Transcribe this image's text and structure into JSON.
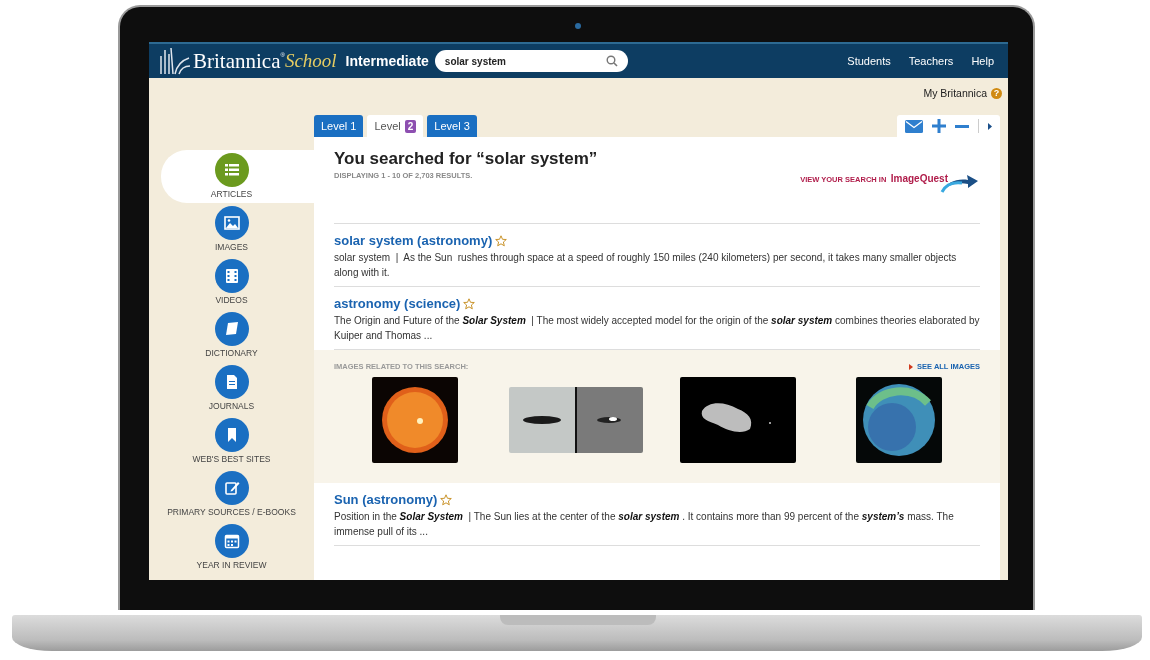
{
  "header": {
    "logo": {
      "brand": "Britannica",
      "registered": "®",
      "product": "School"
    },
    "edition": "Intermediate",
    "search": {
      "value": "solar system"
    },
    "nav": [
      "Students",
      "Teachers",
      "Help"
    ]
  },
  "account": {
    "label": "My Britannica",
    "help": "?"
  },
  "sidebar": {
    "items": [
      {
        "label": "ARTICLES",
        "kind": "articles",
        "selected": true
      },
      {
        "label": "IMAGES",
        "kind": "images",
        "selected": false
      },
      {
        "label": "VIDEOS",
        "kind": "videos",
        "selected": false
      },
      {
        "label": "DICTIONARY",
        "kind": "dictionary",
        "selected": false
      },
      {
        "label": "JOURNALS",
        "kind": "journals",
        "selected": false
      },
      {
        "label": "WEB'S BEST SITES",
        "kind": "sites",
        "selected": false
      },
      {
        "label": "PRIMARY SOURCES / E-BOOKS",
        "kind": "sources",
        "selected": false
      },
      {
        "label": "YEAR IN REVIEW",
        "kind": "year",
        "selected": false
      }
    ]
  },
  "tabs": [
    {
      "label": "Level 1",
      "selected": false
    },
    {
      "label": "Level",
      "badge": "2",
      "selected": true
    },
    {
      "label": "Level 3",
      "selected": false
    }
  ],
  "search_results": {
    "heading": "You searched for “solar system”",
    "count": "DISPLAYING 1 - 10 OF 2,703 RESULTS.",
    "imagequest_link": {
      "prefix": "VIEW YOUR SEARCH IN",
      "brand": "ImageQuest"
    },
    "results": [
      {
        "title": "solar system (astronomy)",
        "snippet": "solar system  |  As the Sun  rushes through space at a speed of roughly 150 miles (240 kilometers) per second, it takes many smaller objects along with it."
      },
      {
        "title": "astronomy (science)",
        "snippet": "The Origin and Future of the **Solar System**  | The most widely accepted model for the origin of the **solar system** combines theories elaborated by Kuiper and Thomas ..."
      }
    ],
    "images": {
      "label": "IMAGES RELATED TO THIS SEARCH:",
      "see_all": "SEE ALL IMAGES",
      "items": [
        {
          "kind": "sun"
        },
        {
          "kind": "blur"
        },
        {
          "kind": "asteroid"
        },
        {
          "kind": "planet"
        }
      ]
    },
    "more_results": [
      {
        "title": "Sun (astronomy)",
        "snippet": "Position in the **Solar System**  | The Sun lies at the center of the **solar system** . It contains more than 99 percent of the **system’s** mass. The immense pull of its ..."
      }
    ]
  }
}
